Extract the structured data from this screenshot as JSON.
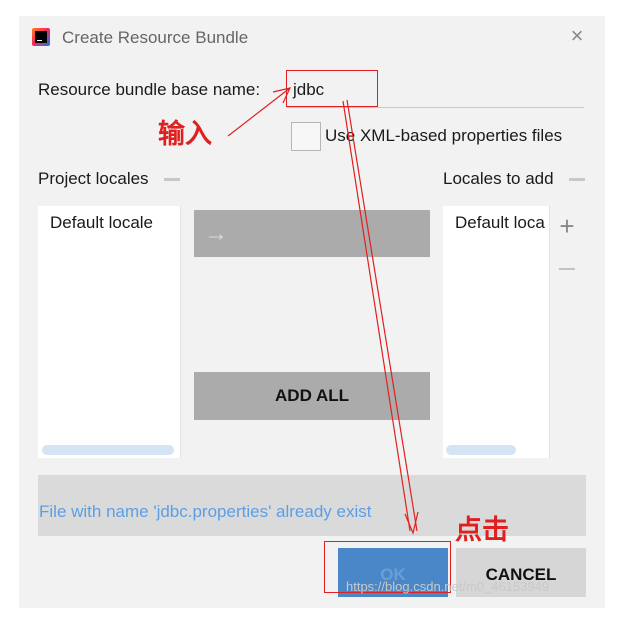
{
  "window": {
    "title": "Create Resource Bundle",
    "app_icon": "intellij-icon",
    "close_icon": "close-icon",
    "close_glyph": "×"
  },
  "form": {
    "base_name_label": "Resource bundle base name:",
    "base_name_value": "jdbc",
    "checkbox_label": "Use XML-based properties files",
    "checkbox_checked": false
  },
  "project_locales": {
    "label": "Project locales",
    "items": [
      "Default locale"
    ]
  },
  "locales_to_add": {
    "label": "Locales to add",
    "items": [
      "Default loca"
    ],
    "plus_glyph": "+"
  },
  "buttons": {
    "move_right_glyph": "→",
    "add_all": "ADD ALL",
    "ok": "OK",
    "cancel": "CANCEL"
  },
  "message": "File with name 'jdbc.properties' already exist",
  "annotations": {
    "input_label": "输入",
    "click_label": "点击",
    "color": "#e02020"
  },
  "watermark": "https://blog.csdn.net/m0_46153949",
  "colors": {
    "dialog_bg": "#f2f2f2",
    "ok_bg": "#4a87c8",
    "message_text": "#5b9ee6"
  }
}
